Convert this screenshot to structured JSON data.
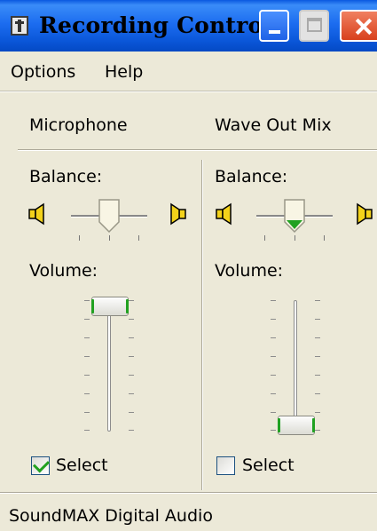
{
  "window": {
    "title": "Recording Control",
    "buttons": {
      "minimize": "minimize",
      "maximize": "maximize",
      "close": "close"
    }
  },
  "menu": {
    "options": "Options",
    "help": "Help"
  },
  "channels": [
    {
      "name": "Microphone",
      "balance_label": "Balance:",
      "balance": 0.5,
      "volume_label": "Volume:",
      "volume": 0.95,
      "select_label": "Select",
      "selected": true
    },
    {
      "name": "Wave Out Mix",
      "balance_label": "Balance:",
      "balance": 0.5,
      "volume_label": "Volume:",
      "volume": 0.05,
      "select_label": "Select",
      "selected": false
    }
  ],
  "status": {
    "text": "SoundMAX Digital Audio"
  },
  "colors": {
    "titlebar": "#0a56d8",
    "thumb_accent": "#21a121",
    "close_button": "#d8401c",
    "face": "#ece9d8"
  },
  "icons": [
    "speaker-left-icon",
    "speaker-right-icon",
    "app-icon"
  ]
}
